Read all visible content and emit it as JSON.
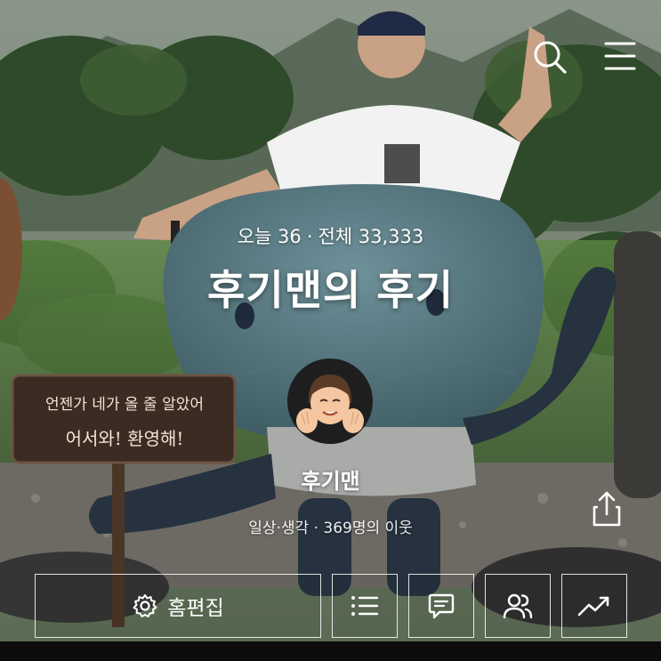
{
  "blog": {
    "stats": {
      "today_label": "오늘 36",
      "total_label": "전체 33,333",
      "separator": "·"
    },
    "title": "후기맨의 후기",
    "nickname": "후기맨",
    "subtitle": "일상·생각 · 369명의 이웃",
    "sign_text_line1": "언젠가 네가 올 줄 알았어",
    "sign_text_line2": "어서와! 환영해!"
  },
  "actions": {
    "edit_home_label": "홈편집"
  },
  "icons": {
    "search": "search-icon",
    "menu": "hamburger-menu-icon",
    "share": "share-icon",
    "settings": "gear-icon",
    "list": "list-icon",
    "comment": "comment-icon",
    "neighbors": "users-icon",
    "stats": "trend-chart-icon"
  },
  "colors": {
    "text": "#ffffff",
    "button_border": "#ffffff",
    "avatar_bg": "#1e1e1e"
  }
}
